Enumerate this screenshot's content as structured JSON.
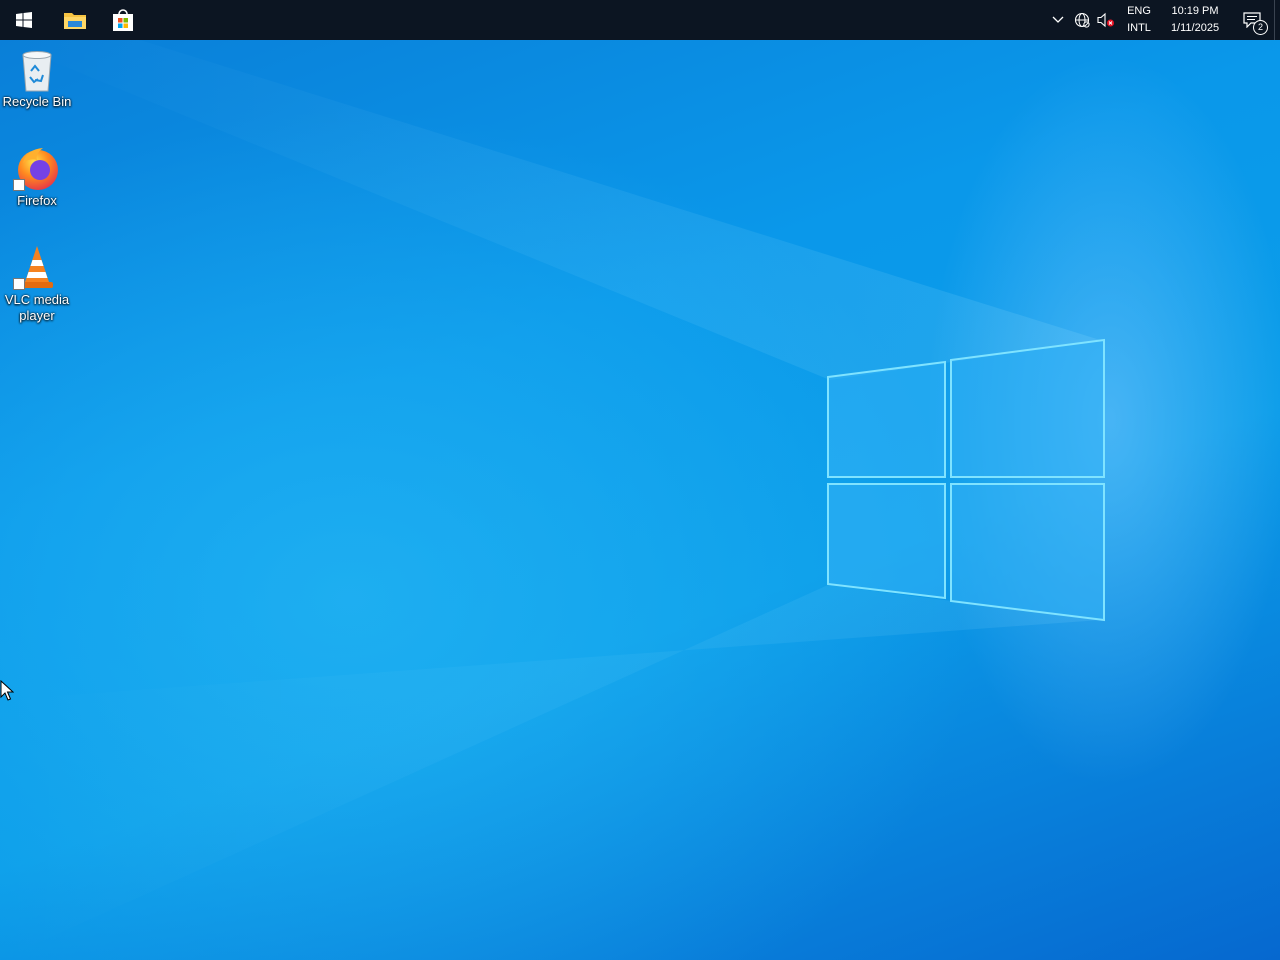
{
  "taskbar": {
    "start_icon": "windows-logo-icon",
    "pinned": [
      {
        "name": "File Explorer",
        "icon": "folder-icon"
      },
      {
        "name": "Microsoft Store",
        "icon": "store-bag-icon"
      }
    ],
    "tray": {
      "chevron_icon": "chevron-up-icon",
      "network_icon": "globe-network-icon",
      "volume_icon": "volume-muted-icon",
      "language_line1": "ENG",
      "language_line2": "INTL",
      "time": "10:19 PM",
      "date": "1/11/2025",
      "notification_count": "2"
    }
  },
  "desktop": {
    "icons": [
      {
        "label": "Recycle Bin",
        "icon": "recycle-bin-icon"
      },
      {
        "label": "Firefox",
        "icon": "firefox-icon"
      },
      {
        "label_line1": "VLC media",
        "label_line2": "player",
        "icon": "vlc-cone-icon"
      }
    ]
  },
  "colors": {
    "taskbar": "#0c1522",
    "wallpaper_accent": "#0a98ea",
    "logo_glow": "#7fdcff"
  }
}
